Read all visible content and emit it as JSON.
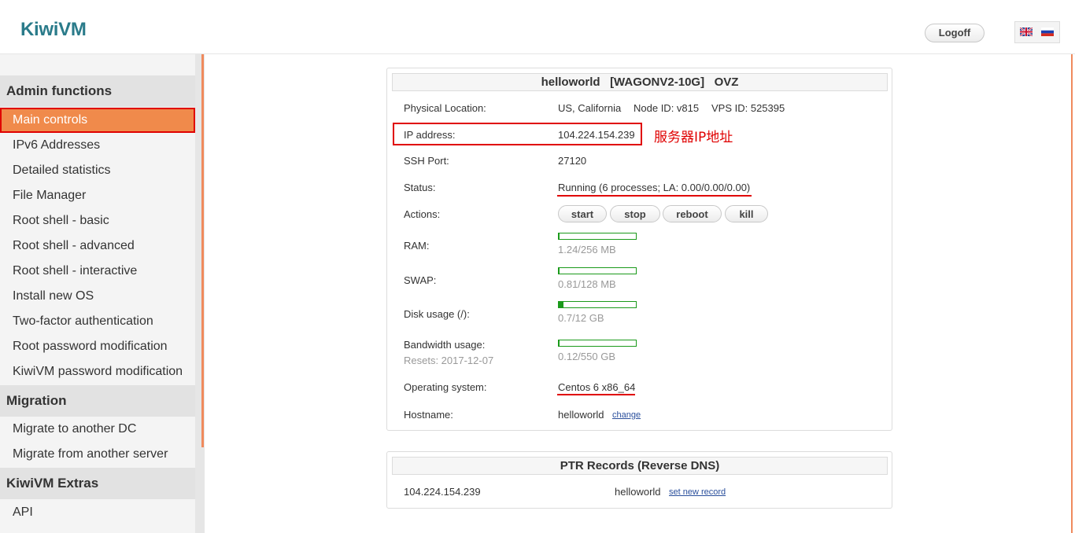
{
  "app": {
    "logo": "KiwiVM",
    "logoff_label": "Logoff"
  },
  "sidebar": {
    "sections": [
      {
        "title": "Admin functions",
        "items": [
          "Main controls",
          "IPv6 Addresses",
          "Detailed statistics",
          "File Manager",
          "Root shell - basic",
          "Root shell - advanced",
          "Root shell - interactive",
          "Install new OS",
          "Two-factor authentication",
          "Root password modification",
          "KiwiVM password modification"
        ]
      },
      {
        "title": "Migration",
        "items": [
          "Migrate to another DC",
          "Migrate from another server"
        ]
      },
      {
        "title": "KiwiVM Extras",
        "items": [
          "API"
        ]
      }
    ],
    "active_item": "Main controls"
  },
  "vps": {
    "title": "helloworld   [WAGONV2-10G]   OVZ",
    "location_label": "Physical Location:",
    "location_value": "US, California",
    "node_id": "Node ID: v815",
    "vps_id": "VPS ID: 525395",
    "ip_label": "IP address:",
    "ip_value": "104.224.154.239",
    "ssh_label": "SSH Port:",
    "ssh_value": "27120",
    "status_label": "Status:",
    "status_value": "Running (6 processes; LA: 0.00/0.00/0.00)",
    "actions_label": "Actions:",
    "actions": {
      "start": "start",
      "stop": "stop",
      "reboot": "reboot",
      "kill": "kill"
    },
    "ram_label": "RAM:",
    "ram_text": "1.24/256 MB",
    "ram_fraction": 0.005,
    "swap_label": "SWAP:",
    "swap_text": "0.81/128 MB",
    "swap_fraction": 0.006,
    "disk_label": "Disk usage (/):",
    "disk_text": "0.7/12 GB",
    "disk_fraction": 0.058,
    "bw_label": "Bandwidth usage:",
    "bw_resets": "Resets: 2017-12-07",
    "bw_text": "0.12/550 GB",
    "bw_fraction": 0.0002,
    "os_label": "Operating system:",
    "os_value": "Centos 6 x86_64",
    "hostname_label": "Hostname:",
    "hostname_value": "helloworld",
    "hostname_change": "change"
  },
  "annotation": {
    "ip_note": "服务器IP地址",
    "color": "#e00000"
  },
  "ptr": {
    "title": "PTR Records (Reverse DNS)",
    "ip": "104.224.154.239",
    "host": "helloworld",
    "set_link": "set new record"
  },
  "colors": {
    "accent": "#f08a4b",
    "bar": "#1a9a1a",
    "logo": "#2a7b8a"
  }
}
